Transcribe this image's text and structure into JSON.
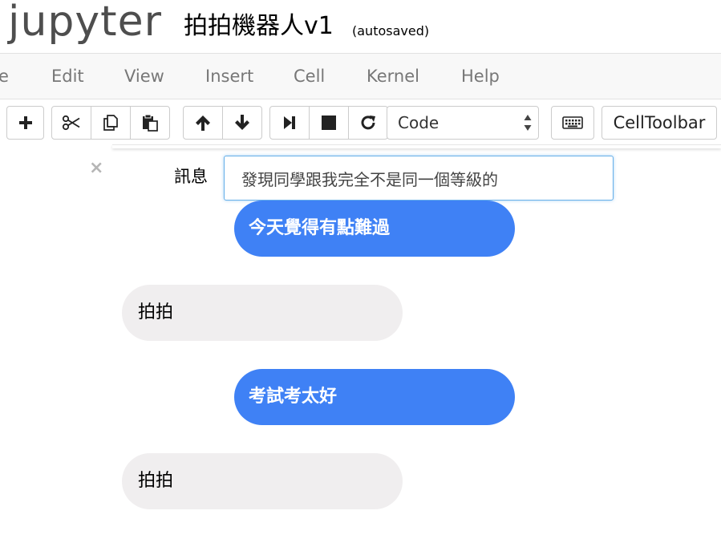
{
  "header": {
    "logo_text": "jupyter",
    "notebook_title": "拍拍機器人v1",
    "autosave_status": "(autosaved)"
  },
  "menubar": {
    "items": [
      "e",
      "Edit",
      "View",
      "Insert",
      "Cell",
      "Kernel",
      "Help"
    ]
  },
  "toolbar": {
    "cell_type": "Code",
    "celltoolbar_label": "CellToolbar",
    "icons": [
      "plus-icon",
      "scissors-icon",
      "copy-icon",
      "paste-icon",
      "arrow-up-icon",
      "arrow-down-icon",
      "step-forward-icon",
      "stop-icon",
      "refresh-icon",
      "keyboard-icon"
    ]
  },
  "chat": {
    "close_symbol": "×",
    "input_label": "訊息",
    "input_value": "發現同學跟我完全不是同一個等級的",
    "messages": [
      {
        "sender": "user",
        "text": "今天覺得有點難過"
      },
      {
        "sender": "bot",
        "text": "拍拍"
      },
      {
        "sender": "user",
        "text": "考試考太好"
      },
      {
        "sender": "bot",
        "text": "拍拍"
      }
    ]
  },
  "colors": {
    "user_bubble": "#3f81f5",
    "bot_bubble": "#f0eeef",
    "input_focus_border": "#66afe9",
    "menu_text": "#777777"
  }
}
